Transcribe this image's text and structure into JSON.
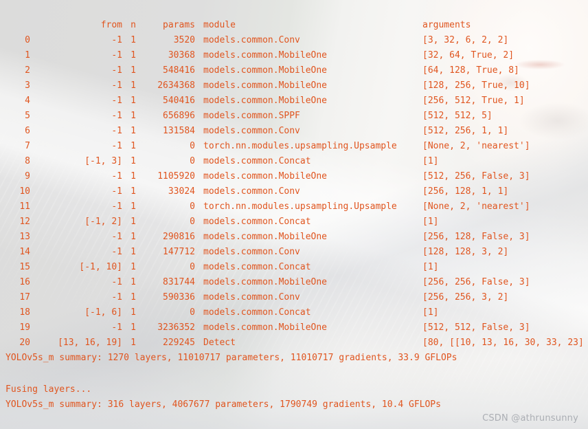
{
  "terminal": {
    "text_color": "#e0551f",
    "background_color": "#dededd",
    "header": {
      "index": "",
      "from": "from",
      "n": "n",
      "params": "params",
      "module": "module",
      "arguments": "arguments"
    },
    "rows": [
      {
        "index": "0",
        "from": "-1",
        "n": "1",
        "params": "3520",
        "module": "models.common.Conv",
        "arguments": "[3, 32, 6, 2, 2]"
      },
      {
        "index": "1",
        "from": "-1",
        "n": "1",
        "params": "30368",
        "module": "models.common.MobileOne",
        "arguments": "[32, 64, True, 2]"
      },
      {
        "index": "2",
        "from": "-1",
        "n": "1",
        "params": "548416",
        "module": "models.common.MobileOne",
        "arguments": "[64, 128, True, 8]"
      },
      {
        "index": "3",
        "from": "-1",
        "n": "1",
        "params": "2634368",
        "module": "models.common.MobileOne",
        "arguments": "[128, 256, True, 10]"
      },
      {
        "index": "4",
        "from": "-1",
        "n": "1",
        "params": "540416",
        "module": "models.common.MobileOne",
        "arguments": "[256, 512, True, 1]"
      },
      {
        "index": "5",
        "from": "-1",
        "n": "1",
        "params": "656896",
        "module": "models.common.SPPF",
        "arguments": "[512, 512, 5]"
      },
      {
        "index": "6",
        "from": "-1",
        "n": "1",
        "params": "131584",
        "module": "models.common.Conv",
        "arguments": "[512, 256, 1, 1]"
      },
      {
        "index": "7",
        "from": "-1",
        "n": "1",
        "params": "0",
        "module": "torch.nn.modules.upsampling.Upsample",
        "arguments": "[None, 2, 'nearest']"
      },
      {
        "index": "8",
        "from": "[-1, 3]",
        "n": "1",
        "params": "0",
        "module": "models.common.Concat",
        "arguments": "[1]"
      },
      {
        "index": "9",
        "from": "-1",
        "n": "1",
        "params": "1105920",
        "module": "models.common.MobileOne",
        "arguments": "[512, 256, False, 3]"
      },
      {
        "index": "10",
        "from": "-1",
        "n": "1",
        "params": "33024",
        "module": "models.common.Conv",
        "arguments": "[256, 128, 1, 1]"
      },
      {
        "index": "11",
        "from": "-1",
        "n": "1",
        "params": "0",
        "module": "torch.nn.modules.upsampling.Upsample",
        "arguments": "[None, 2, 'nearest']"
      },
      {
        "index": "12",
        "from": "[-1, 2]",
        "n": "1",
        "params": "0",
        "module": "models.common.Concat",
        "arguments": "[1]"
      },
      {
        "index": "13",
        "from": "-1",
        "n": "1",
        "params": "290816",
        "module": "models.common.MobileOne",
        "arguments": "[256, 128, False, 3]"
      },
      {
        "index": "14",
        "from": "-1",
        "n": "1",
        "params": "147712",
        "module": "models.common.Conv",
        "arguments": "[128, 128, 3, 2]"
      },
      {
        "index": "15",
        "from": "[-1, 10]",
        "n": "1",
        "params": "0",
        "module": "models.common.Concat",
        "arguments": "[1]"
      },
      {
        "index": "16",
        "from": "-1",
        "n": "1",
        "params": "831744",
        "module": "models.common.MobileOne",
        "arguments": "[256, 256, False, 3]"
      },
      {
        "index": "17",
        "from": "-1",
        "n": "1",
        "params": "590336",
        "module": "models.common.Conv",
        "arguments": "[256, 256, 3, 2]"
      },
      {
        "index": "18",
        "from": "[-1, 6]",
        "n": "1",
        "params": "0",
        "module": "models.common.Concat",
        "arguments": "[1]"
      },
      {
        "index": "19",
        "from": "-1",
        "n": "1",
        "params": "3236352",
        "module": "models.common.MobileOne",
        "arguments": "[512, 512, False, 3]"
      },
      {
        "index": "20",
        "from": "[13, 16, 19]",
        "n": "1",
        "params": "229245",
        "module": "Detect",
        "arguments": "[80, [[10, 13, 16, 30, 33, 23]"
      }
    ],
    "summary_1": "YOLOv5s_m summary: 1270 layers, 11010717 parameters, 11010717 gradients, 33.9 GFLOPs",
    "blank_line": "",
    "fusing": "Fusing layers...",
    "summary_2": "YOLOv5s_m summary: 316 layers, 4067677 parameters, 1790749 gradients, 10.4 GFLOPs"
  },
  "watermark": {
    "text": "CSDN @athrunsunny"
  }
}
